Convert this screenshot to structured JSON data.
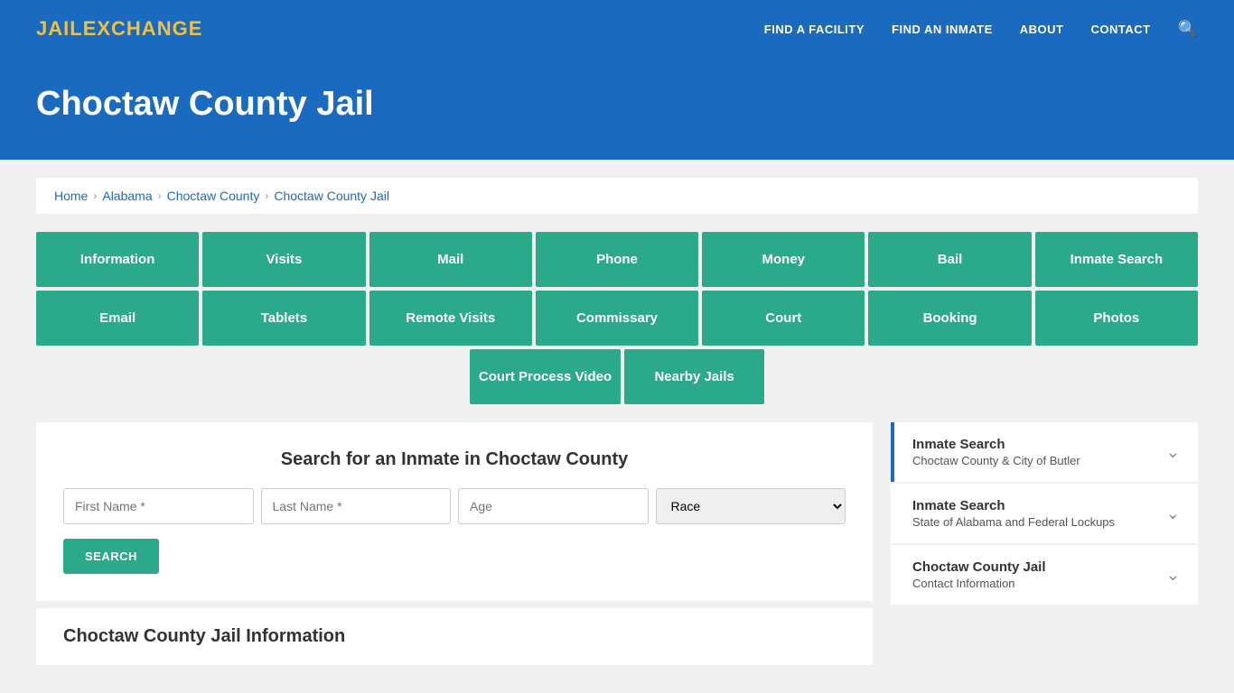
{
  "header": {
    "logo_part1": "JAIL",
    "logo_part2": "EXCHANGE",
    "nav_items": [
      {
        "label": "FIND A FACILITY",
        "href": "#"
      },
      {
        "label": "FIND AN INMATE",
        "href": "#"
      },
      {
        "label": "ABOUT",
        "href": "#"
      },
      {
        "label": "CONTACT",
        "href": "#"
      }
    ]
  },
  "hero": {
    "title": "Choctaw County Jail"
  },
  "breadcrumb": {
    "items": [
      "Home",
      "Alabama",
      "Choctaw County",
      "Choctaw County Jail"
    ]
  },
  "grid_row1": [
    "Information",
    "Visits",
    "Mail",
    "Phone",
    "Money",
    "Bail",
    "Inmate Search"
  ],
  "grid_row2": [
    "Email",
    "Tablets",
    "Remote Visits",
    "Commissary",
    "Court",
    "Booking",
    "Photos"
  ],
  "grid_row3": [
    "Court Process Video",
    "Nearby Jails"
  ],
  "search_section": {
    "title": "Search for an Inmate in Choctaw County",
    "first_name_placeholder": "First Name *",
    "last_name_placeholder": "Last Name *",
    "age_placeholder": "Age",
    "race_placeholder": "Race",
    "search_button": "SEARCH"
  },
  "jail_info": {
    "title": "Choctaw County Jail Information"
  },
  "sidebar": {
    "items": [
      {
        "title": "Inmate Search",
        "sub": "Choctaw County & City of Butler",
        "accent": true
      },
      {
        "title": "Inmate Search",
        "sub": "State of Alabama and Federal Lockups",
        "accent": false
      },
      {
        "title": "Choctaw County Jail",
        "sub": "Contact Information",
        "accent": false
      }
    ]
  }
}
